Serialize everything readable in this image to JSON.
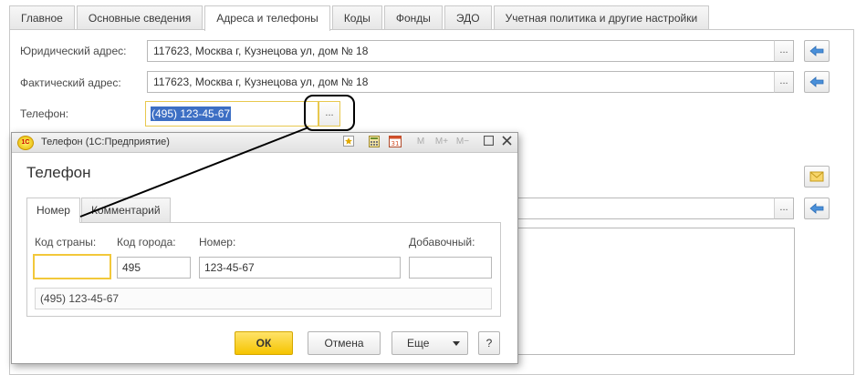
{
  "tabs": [
    {
      "label": "Главное"
    },
    {
      "label": "Основные сведения"
    },
    {
      "label": "Адреса и телефоны"
    },
    {
      "label": "Коды"
    },
    {
      "label": "Фонды"
    },
    {
      "label": "ЭДО"
    },
    {
      "label": "Учетная политика и другие настройки"
    }
  ],
  "active_tab": "Адреса и телефоны",
  "form": {
    "legal_address_label": "Юридический адрес:",
    "legal_address_value": "117623, Москва г, Кузнецова ул, дом № 18",
    "actual_address_label": "Фактический адрес:",
    "actual_address_value": "117623, Москва г, Кузнецова ул, дом № 18",
    "phone_label": "Телефон:",
    "phone_value": "(495) 123-45-67",
    "dots": "..."
  },
  "dialog": {
    "window_title": "Телефон  (1С:Предприятие)",
    "logo_text": "1С",
    "heading": "Телефон",
    "tabs": [
      {
        "label": "Номер"
      },
      {
        "label": "Комментарий"
      }
    ],
    "country_code_label": "Код страны:",
    "country_code_value": "",
    "city_code_label": "Код города:",
    "city_code_value": "495",
    "number_label": "Номер:",
    "number_value": "123-45-67",
    "extension_label": "Добавочный:",
    "extension_value": "",
    "preview": "(495) 123-45-67",
    "ok_label": "ОК",
    "cancel_label": "Отмена",
    "more_label": "Еще",
    "help_label": "?",
    "toolbar": {
      "m": "M",
      "m_plus": "M+",
      "m_minus": "M−",
      "calendar_day": "31"
    }
  },
  "colors": {
    "focus_border": "#f2c83a",
    "selection": "#3d6fc4",
    "ok_button": "#f5c400",
    "arrow_icon": "#4a90d9"
  }
}
